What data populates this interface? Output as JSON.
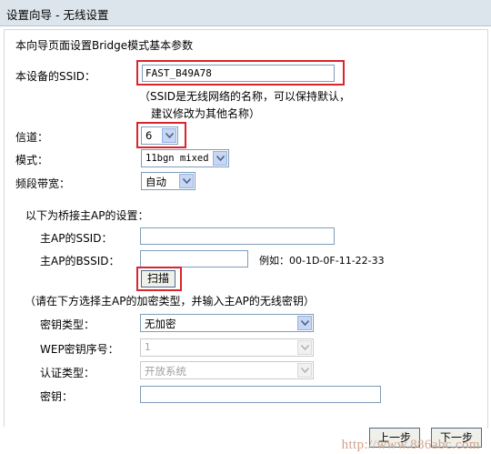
{
  "header": {
    "title": "设置向导 - 无线设置"
  },
  "intro": "本向导页面设置Bridge模式基本参数",
  "ssid": {
    "label": "本设备的SSID：",
    "value": "FAST_B49A78",
    "hint_line1": "（SSID是无线网络的名称，可以保持默认，",
    "hint_line2": "建议修改为其他名称）"
  },
  "channel": {
    "label": "信道：",
    "value": "6"
  },
  "mode": {
    "label": "模式：",
    "value": "11bgn mixed"
  },
  "bandwidth": {
    "label": "频段带宽：",
    "value": "自动"
  },
  "bridge": {
    "section_title": "以下为桥接主AP的设置：",
    "ssid_label": "主AP的SSID：",
    "ssid_value": "",
    "bssid_label": "主AP的BSSID：",
    "bssid_value": "",
    "bssid_example": "例如：00-1D-0F-11-22-33",
    "scan_button": "扫描"
  },
  "security": {
    "instruction": "（请在下方选择主AP的加密类型，并输入主AP的无线密钥）",
    "key_type_label": "密钥类型：",
    "key_type_value": "无加密",
    "wep_index_label": "WEP密钥序号：",
    "wep_index_value": "1",
    "auth_type_label": "认证类型：",
    "auth_type_value": "开放系统",
    "key_label": "密钥：",
    "key_value": ""
  },
  "footer": {
    "prev_button": "上一步",
    "next_button": "下一步"
  },
  "watermark": "http://www.886abc.com",
  "colors": {
    "highlight": "#d9252b",
    "titlebar": "#dde5ec",
    "watermark": "#d0a48c"
  }
}
